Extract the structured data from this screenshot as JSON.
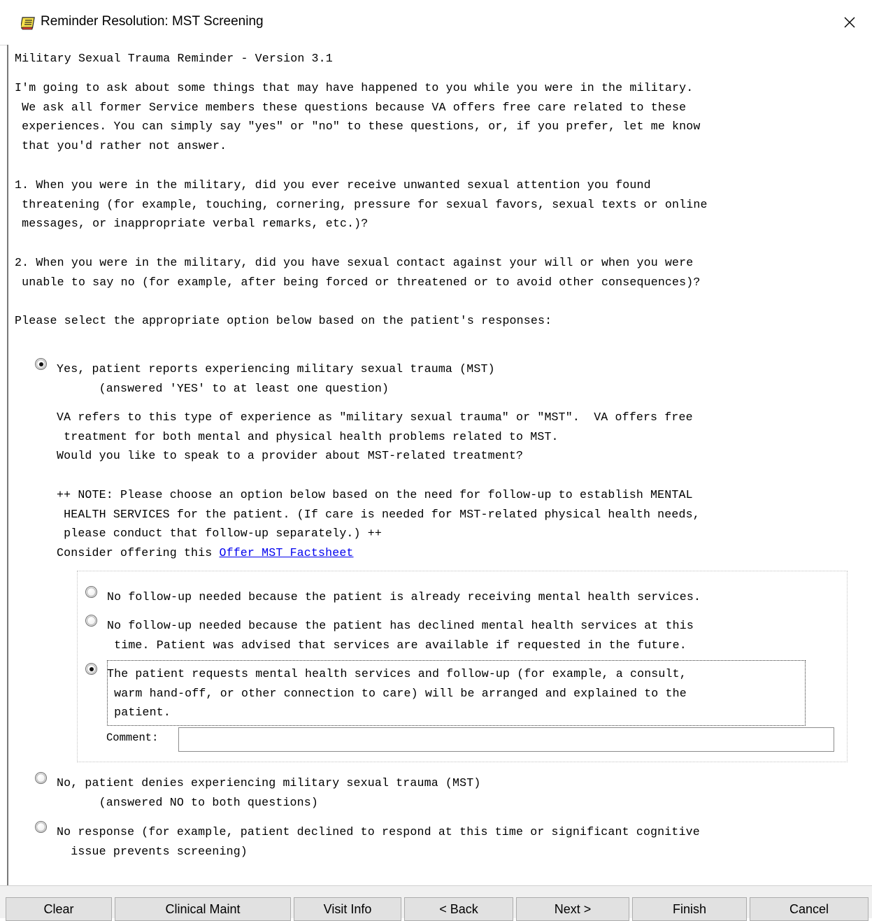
{
  "window": {
    "title": "Reminder Resolution: MST Screening",
    "close_glyph": "✕"
  },
  "content": {
    "heading": "Military Sexual Trauma Reminder - Version 3.1",
    "intro": "I'm going to ask about some things that may have happened to you while you were in the military.\n We ask all former Service members these questions because VA offers free care related to these\n experiences. You can simply say \"yes\" or \"no\" to these questions, or, if you prefer, let me know\n that you'd rather not answer.",
    "question1": "1. When you were in the military, did you ever receive unwanted sexual attention you found\n threatening (for example, touching, cornering, pressure for sexual favors, sexual texts or online\n messages, or inappropriate verbal remarks, etc.)?",
    "question2": "2. When you were in the military, did you have sexual contact against your will or when you were\n unable to say no (for example, after being forced or threatened or to avoid other consequences)?",
    "instruction": "Please select the appropriate option below based on the patient's responses:"
  },
  "options": {
    "yes": {
      "label": "Yes, patient reports experiencing military sexual trauma (MST)\n      (answered 'YES' to at least one question)",
      "checked": true
    },
    "yes_detail": "VA refers to this type of experience as \"military sexual trauma\" or \"MST\".  VA offers free\n treatment for both mental and physical health problems related to MST.\nWould you like to speak to a provider about MST-related treatment?",
    "note": "++ NOTE: Please choose an option below based on the need for follow-up to establish MENTAL\n HEALTH SERVICES for the patient. (If care is needed for MST-related physical health needs,\n please conduct that follow-up separately.) ++",
    "consider_prefix": "Consider offering this ",
    "factsheet_link": "Offer MST Factsheet",
    "followup": [
      {
        "label": "No follow-up needed because the patient is already receiving mental health services.",
        "checked": false
      },
      {
        "label": "No follow-up needed because the patient has declined mental health services at this\n time. Patient was advised that services are available if requested in the future.",
        "checked": false
      },
      {
        "label": "The patient requests mental health services and follow-up (for example, a consult,\n warm hand-off, or other connection to care) will be arranged and explained to the\n patient.",
        "checked": true
      }
    ],
    "comment_label": "Comment:",
    "comment_value": "",
    "no": {
      "label": "No, patient denies experiencing military sexual trauma (MST)\n      (answered NO to both questions)",
      "checked": false
    },
    "no_response": {
      "label": "No response (for example, patient declined to respond at this time or significant cognitive\n  issue prevents screening)",
      "checked": false
    }
  },
  "buttons": {
    "clear": "Clear",
    "clinical_maint": "Clinical Maint",
    "visit_info": "Visit Info",
    "back": "< Back",
    "next": "Next >",
    "finish": "Finish",
    "cancel": "Cancel"
  },
  "colors": {
    "link": "#0000ee",
    "button_face": "#e1e1e1",
    "button_bar": "#f0f0f0"
  }
}
